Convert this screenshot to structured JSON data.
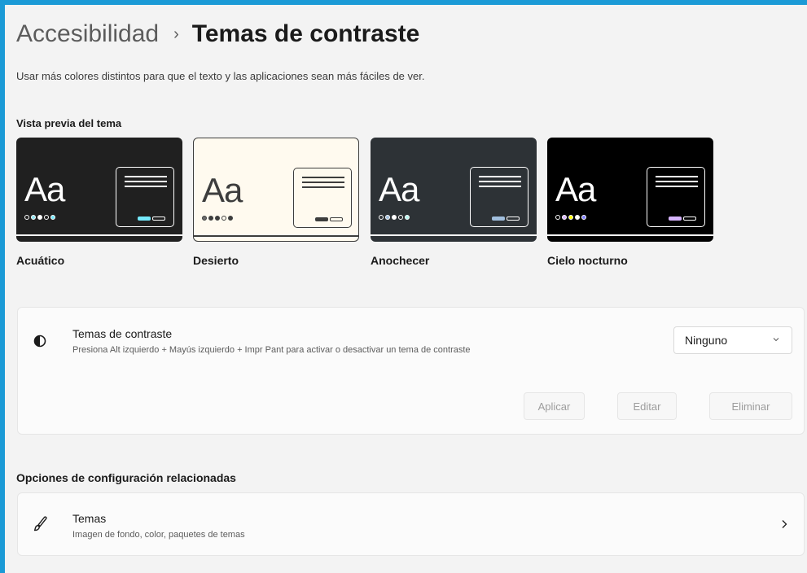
{
  "breadcrumb": {
    "parent": "Accesibilidad",
    "separator": "›",
    "current": "Temas de contraste"
  },
  "description": "Usar más colores distintos para que el texto y las aplicaciones sean más fáciles de ver.",
  "preview": {
    "heading": "Vista previa del tema",
    "themes": [
      {
        "name": "Acuático",
        "sample_text": "Aa",
        "bg": "#202020",
        "fg": "#ffffff",
        "accent": "#75e9fc",
        "dots": [
          "#202020",
          "#8ee3f0",
          "#ffffff",
          "#202020",
          "#75e9fc"
        ]
      },
      {
        "name": "Desierto",
        "sample_text": "Aa",
        "bg": "#fffaef",
        "fg": "#3d3d3d",
        "accent": "#3d3d3d",
        "dots": [
          "#6b6b6b",
          "#3d3d3d",
          "#3d3d3d",
          "#fffaef",
          "#3d3d3d"
        ]
      },
      {
        "name": "Anochecer",
        "sample_text": "Aa",
        "bg": "#2d3236",
        "fg": "#ffffff",
        "accent": "#a1bfde",
        "dots": [
          "#2d3236",
          "#a1bfde",
          "#ffffff",
          "#2d3236",
          "#b6f6f0"
        ]
      },
      {
        "name": "Cielo nocturno",
        "sample_text": "Aa",
        "bg": "#000000",
        "fg": "#ffffff",
        "accent": "#d6b4fd",
        "dots": [
          "#000000",
          "#d6b4fd",
          "#ffff00",
          "#ffffff",
          "#8080ff"
        ]
      }
    ]
  },
  "contrast_setting": {
    "icon": "contrast-icon",
    "title": "Temas de contraste",
    "subtitle": "Presiona Alt izquierdo + Mayús izquierdo + Impr Pant para activar o desactivar un tema de contraste",
    "dropdown_value": "Ninguno",
    "buttons": {
      "apply": "Aplicar",
      "edit": "Editar",
      "delete": "Eliminar"
    }
  },
  "related": {
    "heading": "Opciones de configuración relacionadas",
    "themes": {
      "icon": "brush-icon",
      "title": "Temas",
      "subtitle": "Imagen de fondo, color, paquetes de temas"
    }
  },
  "colors": {
    "frame": "#1b9ad6",
    "background": "#f3f3f3",
    "card": "#fbfbfb"
  }
}
